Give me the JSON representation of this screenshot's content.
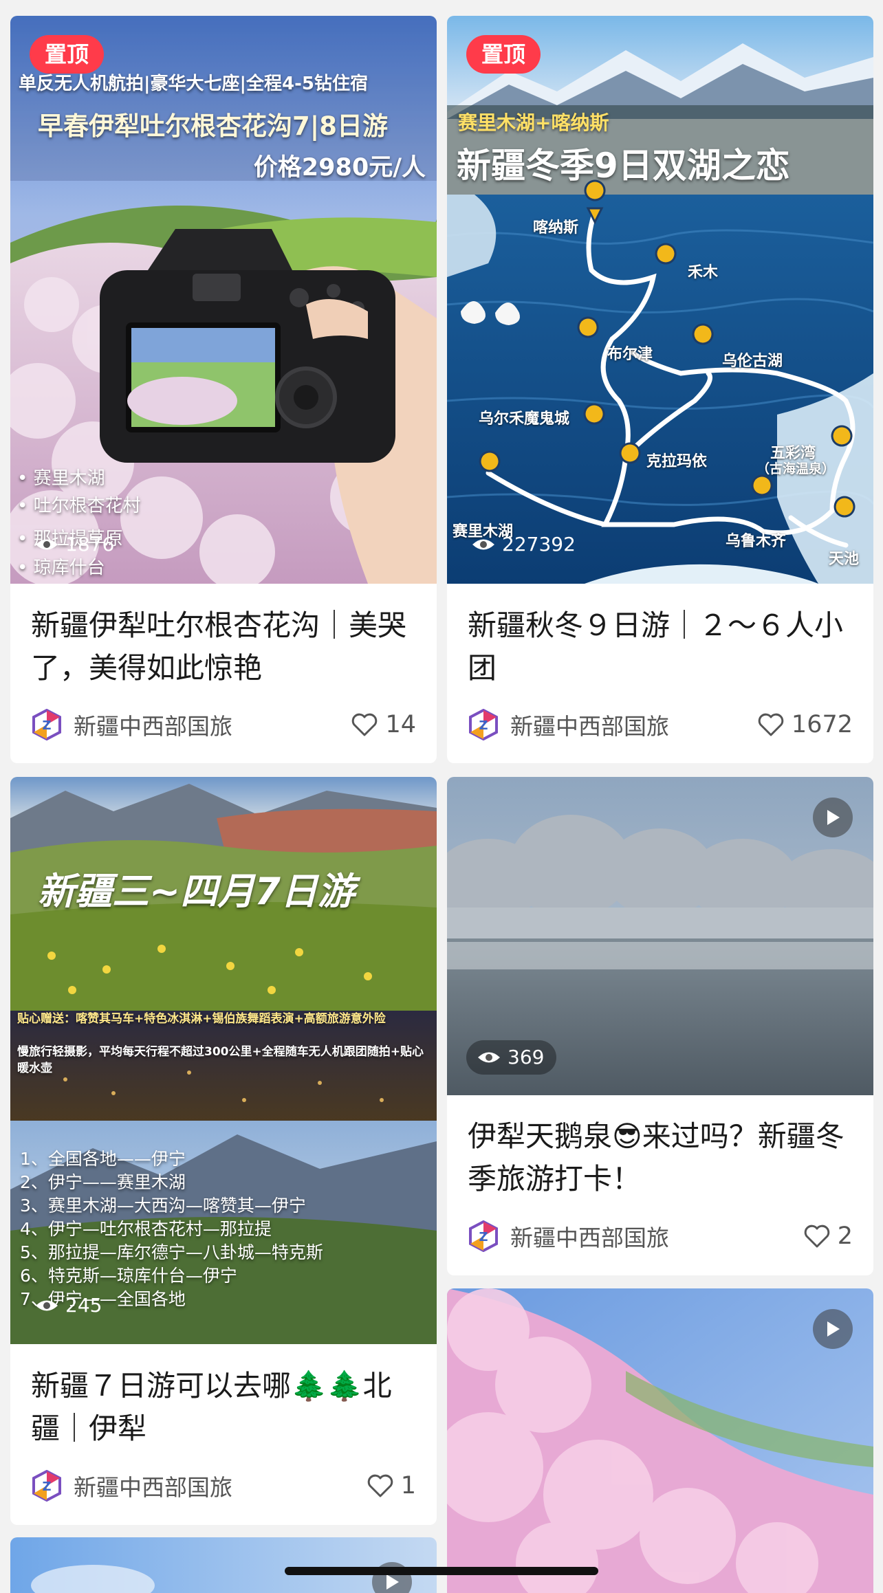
{
  "feed": {
    "cards": [
      {
        "pin": "置顶",
        "overlay": {
          "line1": "单反无人机航拍|豪华大七座|全程4-5钻住宿",
          "line2": "早春伊犁吐尔根杏花沟7|8日游",
          "line3": "价格2980元/人",
          "bullets": [
            "• 赛里木湖",
            "• 吐尔根杏花村",
            "• 那拉提草原",
            "• 琼库什台"
          ]
        },
        "views": "1876",
        "title": "新疆伊犁吐尔根杏花沟｜美哭了，美得如此惊艳",
        "author": "新疆中西部国旅",
        "likes": "14"
      },
      {
        "pin": "置顶",
        "overlay": {
          "subtitle": "赛里木湖+喀纳斯",
          "headline": "新疆冬季9日双湖之恋",
          "places": [
            "喀纳斯",
            "禾木",
            "布尔津",
            "乌伦古湖",
            "乌尔禾魔鬼城",
            "克拉玛依",
            "五彩湾",
            "（古海温泉）",
            "乌鲁木齐",
            "天池",
            "赛里木湖"
          ]
        },
        "views": "227392",
        "title": "新疆秋冬９日游｜２～６人小团",
        "author": "新疆中西部国旅",
        "likes": "1672"
      },
      {
        "overlay": {
          "headline": "新疆三~四月7日游",
          "note1": "贴心赠送：喀赞其马车+特色冰淇淋+锡伯族舞蹈表演+高额旅游意外险",
          "note2": "慢旅行轻摄影，平均每天行程不超过300公里+全程随车无人机跟团随拍+贴心暖水壶",
          "route": [
            "1、全国各地——伊宁",
            "2、伊宁——赛里木湖",
            "3、赛里木湖—大西沟—喀赞其—伊宁",
            "4、伊宁—吐尔根杏花村—那拉提",
            "5、那拉提—库尔德宁—八卦城—特克斯",
            "6、特克斯—琼库什台—伊宁",
            "7、伊宁——全国各地"
          ]
        },
        "views": "245",
        "title": "新疆７日游可以去哪🌲🌲北疆｜伊犁",
        "author": "新疆中西部国旅",
        "likes": "1"
      },
      {
        "views": "369",
        "title": "伊犁天鹅泉😎来过吗？新疆冬季旅游打卡！",
        "author": "新疆中西部国旅",
        "likes": "2"
      },
      {
        "video": true
      },
      {
        "video": true
      }
    ]
  },
  "colors": {
    "pin": "#ff3b4a",
    "background": "#f2f2f2",
    "card": "#ffffff"
  },
  "icons": {
    "views": "eye-icon",
    "likes": "heart-icon",
    "video": "play-icon",
    "avatar": "agency-logo-icon"
  }
}
